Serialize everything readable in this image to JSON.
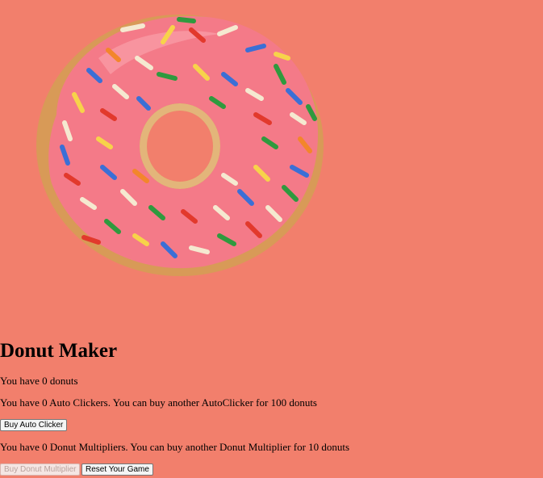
{
  "game": {
    "title": "Donut Maker",
    "donut_count_text": "You have 0 donuts",
    "auto_clicker_text": "You have 0 Auto Clickers. You can buy another AutoClicker for 100 donuts",
    "multiplier_text": "You have 0 Donut Multipliers. You can buy another Donut Multiplier for 10 donuts"
  },
  "buttons": {
    "buy_auto_clicker": "Buy Auto Clicker",
    "buy_donut_multiplier": "Buy Donut Multiplier",
    "reset_game": "Reset Your Game"
  },
  "colors": {
    "background": "#f27f6c",
    "frosting": "#f47c8b",
    "dough": "#d99a55"
  },
  "images": {
    "donut": "donut-image"
  }
}
